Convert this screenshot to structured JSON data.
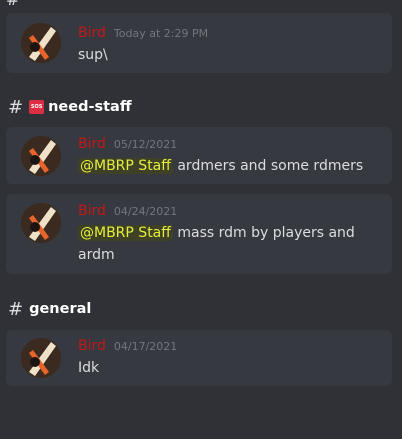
{
  "top_header": {
    "hash": "#"
  },
  "sections": [
    {
      "messages": [
        {
          "author": "Bird",
          "timestamp": "Today at 2:29 PM",
          "text": "sup\\"
        }
      ]
    },
    {
      "channel": "need-staff",
      "channel_icon": "sos-icon",
      "sos_badge": "SOS",
      "messages": [
        {
          "author": "Bird",
          "timestamp": "05/12/2021",
          "mention": "@MBRP Staff",
          "text": " ardmers and some rdmers"
        },
        {
          "author": "Bird",
          "timestamp": "04/24/2021",
          "mention": "@MBRP Staff",
          "text": " mass rdm by players and ardm"
        }
      ]
    },
    {
      "channel": "general",
      "messages": [
        {
          "author": "Bird",
          "timestamp": "04/17/2021",
          "text": "Idk"
        }
      ]
    }
  ],
  "colors": {
    "background": "#2f3136",
    "card": "#36393f",
    "author": "#c3181a",
    "mention_text": "#e6ef3c",
    "timestamp": "#72767d"
  }
}
